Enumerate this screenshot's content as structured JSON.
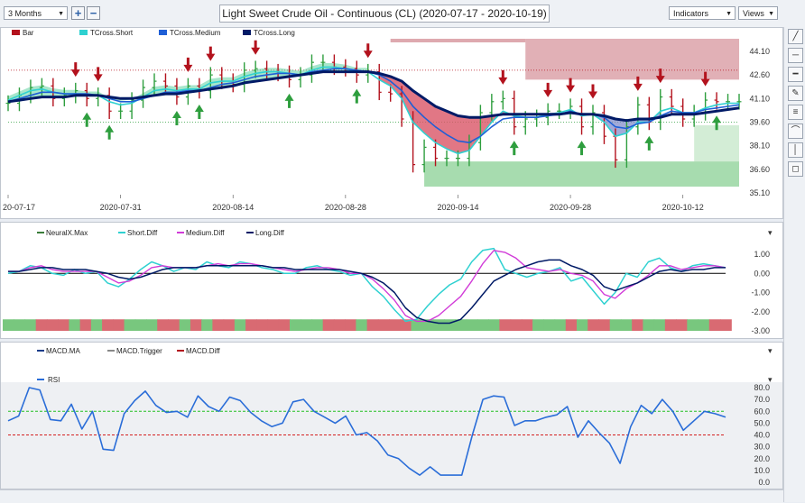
{
  "toolbar": {
    "period": "3 Months",
    "add_label": "+",
    "remove_label": "−",
    "title": "Light Sweet Crude Oil - Continuous (CL) (2020-07-17 - 2020-10-19)",
    "indicators": "Indicators",
    "views": "Views"
  },
  "panel1": {
    "legend": [
      "Bar",
      "TCross.Short",
      "TCross.Medium",
      "TCross.Long"
    ],
    "y_ticks": [
      "44.10",
      "42.60",
      "41.10",
      "39.60",
      "38.10",
      "36.60",
      "35.10"
    ],
    "x_ticks": [
      "20-07-17",
      "2020-07-31",
      "2020-08-14",
      "2020-08-28",
      "2020-09-14",
      "2020-09-28",
      "2020-10-12"
    ]
  },
  "panel2": {
    "legend": [
      "NeuralX.Max",
      "Short.Diff",
      "Medium.Diff",
      "Long.Diff"
    ],
    "y_ticks": [
      "1.00",
      "0.00",
      "-1.00",
      "-2.00",
      "-3.00"
    ]
  },
  "panel3": {
    "legend": [
      "MACD.MA",
      "MACD.Trigger",
      "MACD.Diff"
    ],
    "legend2": [
      "RSI"
    ],
    "y_ticks": [
      "80.0",
      "70.0",
      "60.0",
      "50.0",
      "40.0",
      "30.0",
      "20.0",
      "10.0",
      "0.0"
    ]
  },
  "colors": {
    "up": "#2e9e3e",
    "down": "#b3121d",
    "short": "#2fd1d1",
    "medium": "#1f5fd6",
    "long": "#001a66",
    "magenta": "#d13cd8",
    "rsi": "#2a6dd8",
    "green_ref": "#22c022",
    "red_ref": "#d42020"
  },
  "chart_data": [
    {
      "type": "line",
      "title": "Light Sweet Crude Oil - Continuous (CL) (2020-07-17 - 2020-10-19)",
      "ylim": [
        35.1,
        44.9
      ],
      "x_dates": [
        "2020-07-17",
        "2020-07-20",
        "2020-07-21",
        "2020-07-22",
        "2020-07-23",
        "2020-07-24",
        "2020-07-27",
        "2020-07-28",
        "2020-07-29",
        "2020-07-30",
        "2020-07-31",
        "2020-08-03",
        "2020-08-04",
        "2020-08-05",
        "2020-08-06",
        "2020-08-07",
        "2020-08-10",
        "2020-08-11",
        "2020-08-12",
        "2020-08-13",
        "2020-08-14",
        "2020-08-17",
        "2020-08-18",
        "2020-08-19",
        "2020-08-20",
        "2020-08-21",
        "2020-08-24",
        "2020-08-25",
        "2020-08-26",
        "2020-08-27",
        "2020-08-28",
        "2020-08-31",
        "2020-09-01",
        "2020-09-02",
        "2020-09-03",
        "2020-09-04",
        "2020-09-08",
        "2020-09-09",
        "2020-09-10",
        "2020-09-11",
        "2020-09-14",
        "2020-09-15",
        "2020-09-16",
        "2020-09-17",
        "2020-09-18",
        "2020-09-21",
        "2020-09-22",
        "2020-09-23",
        "2020-09-24",
        "2020-09-25",
        "2020-09-28",
        "2020-09-29",
        "2020-09-30",
        "2020-10-01",
        "2020-10-02",
        "2020-10-05",
        "2020-10-06",
        "2020-10-07",
        "2020-10-08",
        "2020-10-09",
        "2020-10-12",
        "2020-10-13",
        "2020-10-14",
        "2020-10-15",
        "2020-10-16",
        "2020-10-19"
      ],
      "series": [
        {
          "name": "Bar",
          "values": [
            40.8,
            41.3,
            41.8,
            41.9,
            41.1,
            41.3,
            41.6,
            41.1,
            41.3,
            40.3,
            40.3,
            41.0,
            41.8,
            42.2,
            41.9,
            41.2,
            41.9,
            41.6,
            42.6,
            42.2,
            42.0,
            42.9,
            43.0,
            42.8,
            42.7,
            42.3,
            42.6,
            43.4,
            43.4,
            43.1,
            43.0,
            42.6,
            42.8,
            41.5,
            41.4,
            39.8,
            36.9,
            38.0,
            37.3,
            37.3,
            37.3,
            38.3,
            40.2,
            40.9,
            41.1,
            39.3,
            39.8,
            39.9,
            40.3,
            40.3,
            40.6,
            39.3,
            40.2,
            38.7,
            37.2,
            39.3,
            40.7,
            39.6,
            41.2,
            40.6,
            39.8,
            40.2,
            41.0,
            40.9,
            40.9,
            40.9
          ]
        },
        {
          "name": "TCross.Short",
          "values": [
            41.0,
            41.3,
            41.6,
            41.7,
            41.5,
            41.4,
            41.4,
            41.3,
            41.3,
            40.9,
            40.7,
            40.8,
            41.2,
            41.6,
            41.7,
            41.6,
            41.7,
            41.7,
            42.1,
            42.2,
            42.2,
            42.5,
            42.7,
            42.8,
            42.8,
            42.7,
            42.6,
            42.9,
            43.1,
            43.1,
            43.0,
            42.8,
            42.8,
            42.3,
            41.9,
            41.1,
            39.6,
            38.9,
            38.3,
            37.9,
            37.6,
            37.8,
            38.7,
            39.6,
            40.3,
            40.0,
            39.9,
            39.9,
            40.1,
            40.2,
            40.4,
            40.0,
            40.1,
            39.6,
            38.7,
            38.9,
            39.6,
            39.6,
            40.3,
            40.5,
            40.2,
            40.2,
            40.5,
            40.7,
            40.8,
            40.8
          ]
        },
        {
          "name": "TCross.Medium",
          "values": [
            40.9,
            41.1,
            41.3,
            41.5,
            41.5,
            41.4,
            41.4,
            41.4,
            41.3,
            41.1,
            40.9,
            40.9,
            41.1,
            41.3,
            41.5,
            41.5,
            41.6,
            41.6,
            41.8,
            42.0,
            42.1,
            42.3,
            42.5,
            42.6,
            42.7,
            42.7,
            42.6,
            42.8,
            42.9,
            43.0,
            43.0,
            42.9,
            42.8,
            42.6,
            42.2,
            41.6,
            40.6,
            39.9,
            39.3,
            38.8,
            38.4,
            38.3,
            38.7,
            39.3,
            39.8,
            39.9,
            39.9,
            39.9,
            40.0,
            40.1,
            40.3,
            40.1,
            40.1,
            39.9,
            39.3,
            39.2,
            39.5,
            39.6,
            40.0,
            40.3,
            40.2,
            40.2,
            40.4,
            40.5,
            40.6,
            40.7
          ]
        },
        {
          "name": "TCross.Long",
          "values": [
            40.9,
            41.0,
            41.1,
            41.2,
            41.2,
            41.2,
            41.3,
            41.3,
            41.3,
            41.2,
            41.1,
            41.1,
            41.2,
            41.3,
            41.4,
            41.4,
            41.5,
            41.6,
            41.7,
            41.8,
            41.9,
            42.1,
            42.2,
            42.3,
            42.4,
            42.5,
            42.6,
            42.7,
            42.8,
            42.8,
            42.8,
            42.8,
            42.8,
            42.7,
            42.5,
            42.2,
            41.6,
            41.1,
            40.6,
            40.3,
            40.0,
            39.9,
            39.9,
            40.0,
            40.1,
            40.1,
            40.1,
            40.1,
            40.1,
            40.1,
            40.2,
            40.1,
            40.1,
            40.0,
            39.8,
            39.7,
            39.8,
            39.8,
            39.9,
            40.1,
            40.1,
            40.1,
            40.2,
            40.3,
            40.4,
            40.5
          ]
        }
      ]
    },
    {
      "type": "line",
      "ylim": [
        -3.0,
        1.8
      ],
      "series": [
        {
          "name": "Short.Diff",
          "values": [
            0.0,
            0.1,
            0.4,
            0.3,
            0.0,
            -0.1,
            0.2,
            0.0,
            0.1,
            -0.5,
            -0.7,
            -0.3,
            0.2,
            0.6,
            0.4,
            0.1,
            0.3,
            0.2,
            0.6,
            0.4,
            0.3,
            0.6,
            0.5,
            0.3,
            0.2,
            0.0,
            0.0,
            0.3,
            0.4,
            0.2,
            0.1,
            -0.1,
            0.0,
            -0.7,
            -1.2,
            -1.9,
            -2.5,
            -2.4,
            -1.7,
            -1.1,
            -0.6,
            -0.3,
            0.6,
            1.2,
            1.3,
            0.2,
            0.0,
            -0.2,
            0.0,
            0.1,
            0.3,
            -0.4,
            -0.2,
            -0.9,
            -1.6,
            -1.0,
            0.0,
            -0.2,
            0.6,
            0.8,
            0.3,
            0.1,
            0.4,
            0.5,
            0.4,
            0.3
          ]
        },
        {
          "name": "Medium.Diff",
          "values": [
            0.1,
            0.1,
            0.3,
            0.4,
            0.2,
            0.1,
            0.1,
            0.1,
            0.1,
            -0.2,
            -0.5,
            -0.4,
            -0.1,
            0.3,
            0.4,
            0.3,
            0.3,
            0.3,
            0.4,
            0.5,
            0.4,
            0.5,
            0.5,
            0.4,
            0.3,
            0.2,
            0.1,
            0.2,
            0.3,
            0.3,
            0.2,
            0.0,
            0.0,
            -0.3,
            -0.8,
            -1.4,
            -2.2,
            -2.5,
            -2.5,
            -2.2,
            -1.7,
            -1.2,
            -0.4,
            0.5,
            1.2,
            1.1,
            0.8,
            0.3,
            0.2,
            0.1,
            0.2,
            0.0,
            -0.1,
            -0.4,
            -1.1,
            -1.3,
            -0.8,
            -0.5,
            -0.1,
            0.4,
            0.4,
            0.2,
            0.3,
            0.4,
            0.4,
            0.3
          ]
        },
        {
          "name": "Long.Diff",
          "values": [
            0.1,
            0.1,
            0.2,
            0.3,
            0.3,
            0.2,
            0.2,
            0.2,
            0.1,
            0.0,
            -0.2,
            -0.3,
            -0.2,
            0.0,
            0.2,
            0.3,
            0.3,
            0.3,
            0.4,
            0.4,
            0.4,
            0.4,
            0.4,
            0.4,
            0.3,
            0.3,
            0.2,
            0.2,
            0.2,
            0.2,
            0.2,
            0.1,
            0.0,
            -0.2,
            -0.5,
            -1.0,
            -1.8,
            -2.3,
            -2.5,
            -2.6,
            -2.6,
            -2.4,
            -1.8,
            -1.1,
            -0.4,
            -0.1,
            0.2,
            0.4,
            0.6,
            0.7,
            0.7,
            0.4,
            0.2,
            -0.1,
            -0.7,
            -0.9,
            -0.7,
            -0.5,
            -0.2,
            0.1,
            0.2,
            0.1,
            0.2,
            0.2,
            0.3,
            0.3
          ]
        }
      ]
    },
    {
      "type": "line",
      "ylim": [
        0,
        85
      ],
      "reference_lines": [
        60,
        40
      ],
      "series": [
        {
          "name": "RSI",
          "values": [
            52,
            56,
            80,
            78,
            53,
            52,
            66,
            45,
            60,
            28,
            27,
            58,
            69,
            77,
            65,
            59,
            60,
            55,
            73,
            64,
            60,
            72,
            69,
            59,
            52,
            47,
            50,
            68,
            70,
            60,
            55,
            50,
            56,
            40,
            42,
            35,
            23,
            20,
            12,
            6,
            13,
            6,
            6,
            6,
            40,
            70,
            73,
            72,
            48,
            52,
            52,
            55,
            57,
            64,
            38,
            52,
            42,
            33,
            16,
            47,
            65,
            58,
            70,
            60,
            44,
            52,
            60,
            58,
            55
          ]
        }
      ]
    }
  ]
}
